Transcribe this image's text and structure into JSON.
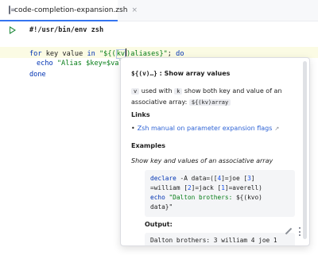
{
  "tab": {
    "label": "code-completion-expansion.zsh",
    "close": "×"
  },
  "code": {
    "shebang": "#!/usr/bin/env zsh",
    "line2": {
      "for": "for",
      "vars": " key value ",
      "in": "in",
      "str_open": " \"${(",
      "kv": "kv",
      "str_close": ")aliases}\"",
      "semi": "; ",
      "do": "do"
    },
    "line3": {
      "echo": "echo",
      "str": " \"Alias $key=$valu"
    },
    "line4": "done"
  },
  "popup": {
    "header_code": "${(v)…}",
    "header_text": " : Show array values",
    "para": {
      "chip_v": "v",
      "t1": " used with ",
      "chip_k": "k",
      "t2": " show both key and value of an associative array: ",
      "chip_kv": "${(kv)array"
    },
    "links_title": "Links",
    "link_bullet": "•",
    "link_text": "Zsh manual on parameter expansion flags",
    "link_ext": "↗",
    "examples_title": "Examples",
    "example_desc": "Show key and values of an associative array",
    "example_code": {
      "l1_kw": "declare",
      "l1_a": " -A data=([",
      "l1_n1": "4",
      "l1_b": "]=joe [",
      "l1_n2": "3",
      "l1_c": "]",
      "l2_a": "=william [",
      "l2_n1": "2",
      "l2_b": "]=jack [",
      "l2_n2": "1",
      "l2_c": "]=averell)",
      "l3_kw": "echo",
      "l3_str": " \"Dalton brothers: ",
      "l3_rest": "${(kvo)",
      "l4": "data}\""
    },
    "output_label": "Output:",
    "output_text": "Dalton brothers: 3 william 4 joe 1"
  },
  "colors": {
    "accent": "#3574f0",
    "keyword": "#0033b3",
    "string": "#067d17",
    "link": "#2f64d6",
    "run": "#208a3c"
  }
}
